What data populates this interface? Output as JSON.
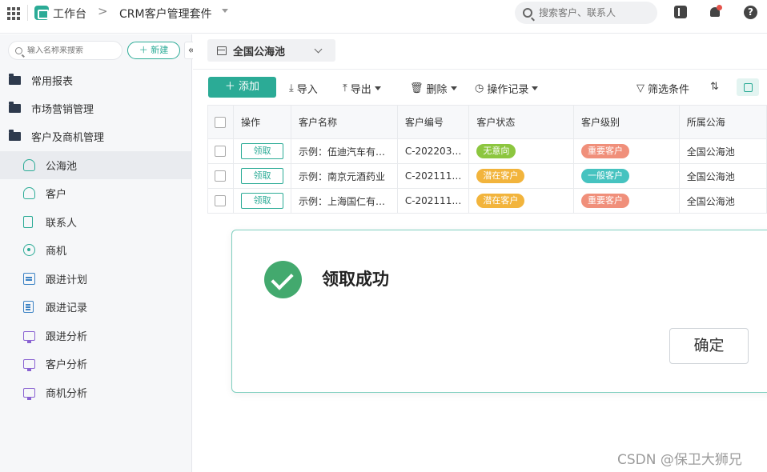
{
  "topbar": {
    "workbench": "工作台",
    "separator": ">",
    "app_name": "CRM客户管理套件",
    "search_placeholder": "搜索客户、联系人",
    "help_glyph": "?"
  },
  "sidebar": {
    "search_placeholder": "输入名称来搜索",
    "new_button": "＋ 新建",
    "collapse_glyph": "«",
    "groups": [
      {
        "label": "常用报表"
      },
      {
        "label": "市场营销管理"
      },
      {
        "label": "客户及商机管理"
      }
    ],
    "items": [
      {
        "label": "公海池",
        "icon": "person-icon",
        "active": true
      },
      {
        "label": "客户",
        "icon": "person-icon"
      },
      {
        "label": "联系人",
        "icon": "contact-card-icon"
      },
      {
        "label": "商机",
        "icon": "target-icon"
      },
      {
        "label": "跟进计划",
        "icon": "calendar-icon"
      },
      {
        "label": "跟进记录",
        "icon": "record-doc-icon"
      },
      {
        "label": "跟进分析",
        "icon": "monitor-chart-icon"
      },
      {
        "label": "客户分析",
        "icon": "monitor-chart-icon"
      },
      {
        "label": "商机分析",
        "icon": "monitor-chart-icon"
      }
    ]
  },
  "main": {
    "view_name": "全国公海池",
    "toolbar": {
      "add": "＋ 添加",
      "import": "导入",
      "export": "导出",
      "delete": "删除",
      "history": "操作记录",
      "filter": "筛选条件"
    },
    "table": {
      "headers": [
        "操作",
        "客户名称",
        "客户编号",
        "客户状态",
        "客户级别",
        "所属公海"
      ],
      "rows": [
        {
          "action": "领取",
          "name": "示例：伍迪汽车有…",
          "code": "C-202203…",
          "status": "无意向",
          "status_color": "#8cc63f",
          "level": "重要客户",
          "level_color": "#f08f7a",
          "pool": "全国公海池"
        },
        {
          "action": "领取",
          "name": "示例：南京元酒药业",
          "code": "C-202111…",
          "status": "潜在客户",
          "status_color": "#f2b43c",
          "level": "一般客户",
          "level_color": "#46c3c0",
          "pool": "全国公海池"
        },
        {
          "action": "领取",
          "name": "示例：上海国仁有…",
          "code": "C-202111…",
          "status": "潜在客户",
          "status_color": "#f2b43c",
          "level": "重要客户",
          "level_color": "#f08f7a",
          "pool": "全国公海池"
        }
      ]
    }
  },
  "dialog": {
    "title": "领取成功",
    "confirm": "确定"
  },
  "watermark": "CSDN @保卫大狮兄",
  "colors": {
    "accent": "#2bab96",
    "success": "#43a96e"
  }
}
